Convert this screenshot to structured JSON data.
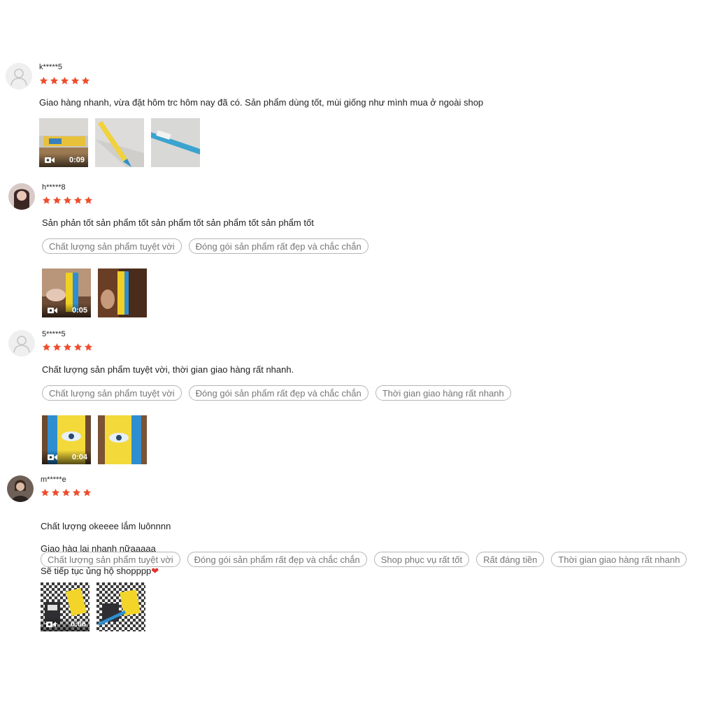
{
  "colors": {
    "star": "#ee4d2d",
    "tag_border": "#b5b5b5",
    "tag_text": "#777777"
  },
  "reviews": [
    {
      "username": "k*****5",
      "rating": 5,
      "avatar": "default-avatar-icon",
      "text": "Giao hàng nhanh, vừa đặt hôm trc hôm nay đã có. Sản phẩm dùng tốt, mùi giống như mình mua ở ngoài shop",
      "tags": [],
      "video_duration": "0:09",
      "media_count": 3
    },
    {
      "username": "h*****8",
      "rating": 5,
      "avatar": "user-photo",
      "text": "Sản phản tốt sản phẩm tốt sản phẩm tốt sản phẩm tốt sản phẩm tốt",
      "tags": [
        "Chất lượng sản phẩm tuyệt vời",
        "Đóng gói sản phẩm rất đẹp và chắc chắn"
      ],
      "video_duration": "0:05",
      "media_count": 2
    },
    {
      "username": "5*****5",
      "rating": 5,
      "avatar": "default-avatar-icon",
      "text": "Chất lượng sản phẩm tuyệt vời, thời gian giao hàng rất nhanh.",
      "tags": [
        "Chất lượng sản phẩm tuyệt vời",
        "Đóng gói sản phẩm rất đẹp và chắc chắn",
        "Thời gian giao hàng rất nhanh"
      ],
      "video_duration": "0:04",
      "media_count": 2
    },
    {
      "username": "m*****e",
      "rating": 5,
      "avatar": "user-photo",
      "text_lines": [
        "Chất lượng okeeee lắm luônnnn",
        "Giao hàg lại nhanh nữaaaaa",
        "Sẽ tiếp tục ủng hộ shopppp"
      ],
      "emoji": "❤",
      "tags": [
        "Chất lượng sản phẩm tuyệt vời",
        "Đóng gói sản phẩm rất đẹp và chắc chắn",
        "Shop phục vụ rất tốt",
        "Rất đáng tiền",
        "Thời gian giao hàng rất nhanh"
      ],
      "video_duration": "0:06",
      "media_count": 2
    }
  ]
}
